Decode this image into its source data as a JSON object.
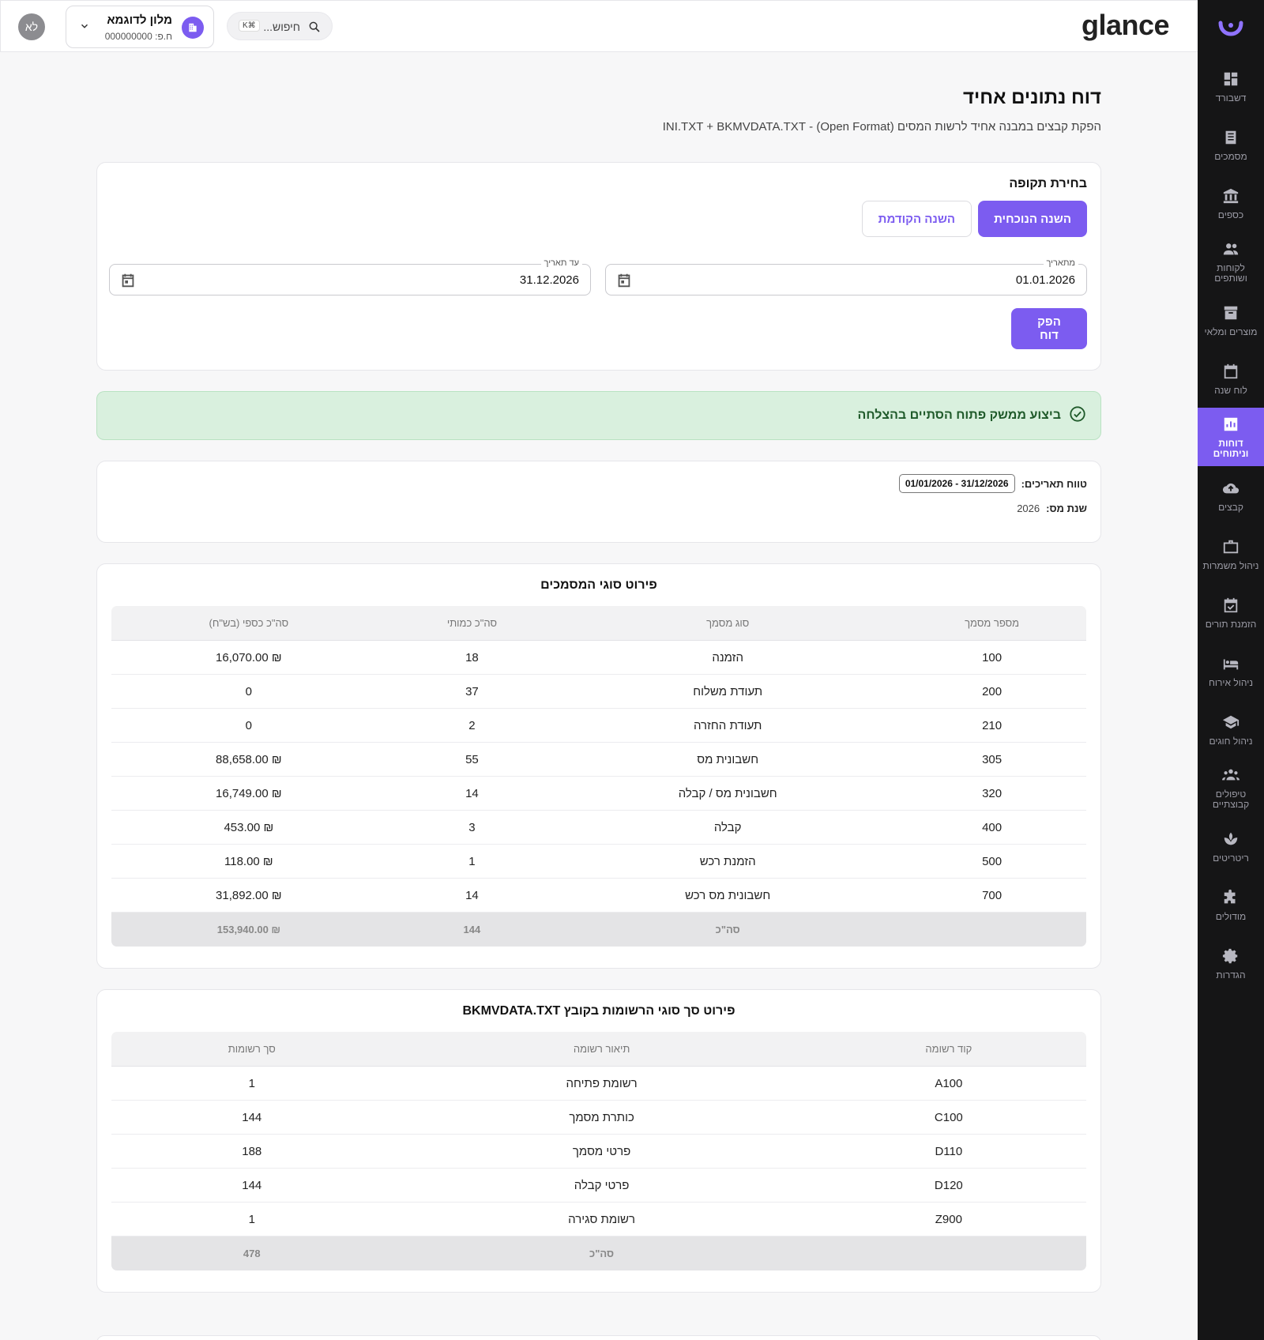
{
  "app": {
    "brand": "glance",
    "avatar_initials": "לא"
  },
  "business": {
    "name": "מלון לדוגמא",
    "id_line": "ח.פ: 000000000"
  },
  "search": {
    "placeholder": "חיפוש...",
    "shortcut": "K⌘"
  },
  "sidebar": {
    "items": [
      {
        "label": "דשבורד",
        "icon": "dashboard-icon"
      },
      {
        "label": "מסמכים",
        "icon": "documents-icon"
      },
      {
        "label": "כספים",
        "icon": "bank-icon"
      },
      {
        "label": "לקוחות ושותפים",
        "icon": "people-icon"
      },
      {
        "label": "מוצרים ומלאי",
        "icon": "archive-icon"
      },
      {
        "label": "לוח שנה",
        "icon": "calendar-icon"
      },
      {
        "label": "דוחות וניתוחים",
        "icon": "chart-icon",
        "active": true
      },
      {
        "label": "קבצים",
        "icon": "cloud-upload-icon"
      },
      {
        "label": "ניהול משמרות",
        "icon": "briefcase-icon"
      },
      {
        "label": "הזמנת תורים",
        "icon": "calendar-check-icon"
      },
      {
        "label": "ניהול אירוח",
        "icon": "bed-icon"
      },
      {
        "label": "ניהול חוגים",
        "icon": "school-icon"
      },
      {
        "label": "טיפולים קבוצתיים",
        "icon": "groups-icon"
      },
      {
        "label": "ריטריטים",
        "icon": "spa-icon"
      },
      {
        "label": "מודולים",
        "icon": "puzzle-icon"
      },
      {
        "label": "הגדרות",
        "icon": "gear-icon"
      }
    ]
  },
  "page": {
    "title": "דוח נתונים אחיד",
    "subtitle": "הפקת קבצים במבנה אחיד לרשות המסים (Open Format) - INI.TXT + BKMVDATA.TXT"
  },
  "period": {
    "title": "בחירת תקופה",
    "current_year_label": "השנה הנוכחית",
    "previous_year_label": "השנה הקודמת",
    "from_label": "מתאריך",
    "from_value": "01.01.2026",
    "to_label": "עד תאריך",
    "to_value": "31.12.2026",
    "generate_label": "הפק דוח"
  },
  "success_message": "ביצוע ממשק פתוח הסתיים בהצלחה",
  "info": {
    "range_label": "טווח תאריכים:",
    "range_value": "01/01/2026 - 31/12/2026",
    "tax_year_label": "שנת מס:",
    "tax_year_value": "2026"
  },
  "docs_table": {
    "title": "פירוט סוגי המסמכים",
    "headers": [
      "מספר מסמך",
      "סוג מסמך",
      "סה\"כ כמותי",
      "סה\"כ כספי (בש\"ח)"
    ],
    "rows": [
      [
        "100",
        "הזמנה",
        "18",
        "₪ 16,070.00"
      ],
      [
        "200",
        "תעודת משלוח",
        "37",
        "0"
      ],
      [
        "210",
        "תעודת החזרה",
        "2",
        "0"
      ],
      [
        "305",
        "חשבונית מס",
        "55",
        "₪ 88,658.00"
      ],
      [
        "320",
        "חשבונית מס / קבלה",
        "14",
        "₪ 16,749.00"
      ],
      [
        "400",
        "קבלה",
        "3",
        "₪ 453.00"
      ],
      [
        "500",
        "הזמנת רכש",
        "1",
        "₪ 118.00"
      ],
      [
        "700",
        "חשבונית מס רכש",
        "14",
        "₪ 31,892.00"
      ]
    ],
    "total": {
      "label": "סה\"כ",
      "count": "144",
      "amount": "₪ 153,940.00"
    }
  },
  "records_table": {
    "title": "פירוט סך סוגי הרשומות בקובץ BKMVDATA.TXT",
    "headers": [
      "קוד רשומה",
      "תיאור רשומה",
      "סך רשומות"
    ],
    "rows": [
      [
        "A100",
        "רשומת פתיחה",
        "1"
      ],
      [
        "C100",
        "כותרת מסמך",
        "144"
      ],
      [
        "D110",
        "פרטי מסמך",
        "188"
      ],
      [
        "D120",
        "פרטי קבלה",
        "144"
      ],
      [
        "Z900",
        "רשומת סגירה",
        "1"
      ]
    ],
    "total": {
      "label": "סה\"כ",
      "count": "478"
    }
  },
  "colors": {
    "accent": "#7c5cf0",
    "sidebar_bg": "#151516",
    "success_bg": "#d9f0de"
  }
}
